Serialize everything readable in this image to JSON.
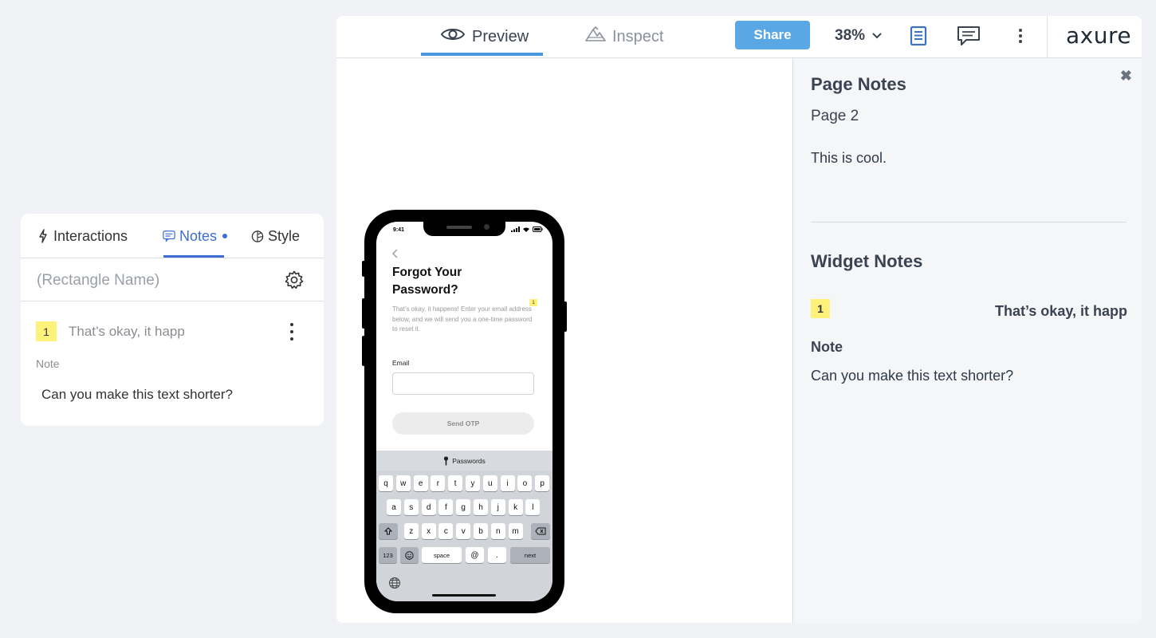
{
  "left_panel": {
    "tabs": [
      {
        "label": "Interactions"
      },
      {
        "label": "Notes"
      },
      {
        "label": "Style"
      }
    ],
    "name_placeholder": "(Rectangle Name)",
    "note": {
      "badge": "1",
      "title": "That’s okay, it happ",
      "label": "Note",
      "text": "Can you make this text shorter?"
    }
  },
  "toolbar": {
    "preview_label": "Preview",
    "inspect_label": "Inspect",
    "share_label": "Share",
    "zoom": "38%",
    "logo": "axure"
  },
  "phone": {
    "time": "9:41",
    "title": "Forgot Your Password?",
    "subtitle": "That’s okay, it happens! Enter your email address below, and we will send you a one-time password to reset it.",
    "pin_badge": "1",
    "email_label": "Email",
    "email_value": "",
    "send_button": "Send OTP",
    "keyboard": {
      "passwords_label": "Passwords",
      "row1": [
        "q",
        "w",
        "e",
        "r",
        "t",
        "y",
        "u",
        "i",
        "o",
        "p"
      ],
      "row2": [
        "a",
        "s",
        "d",
        "f",
        "g",
        "h",
        "j",
        "k",
        "l"
      ],
      "row3": [
        "z",
        "x",
        "c",
        "v",
        "b",
        "n",
        "m"
      ],
      "numbers": "123",
      "space": "space",
      "at": "@",
      "dot": ".",
      "next": "next"
    }
  },
  "notes_panel": {
    "page_heading": "Page Notes",
    "page_name": "Page 2",
    "page_note": "This is cool.",
    "widget_heading": "Widget Notes",
    "widget_badge": "1",
    "widget_title": "That’s okay, it happ",
    "note_label": "Note",
    "note_text": "Can you make this text shorter?"
  },
  "colors": {
    "accent": "#3f6ed3",
    "share": "#5aa7e6",
    "badge": "#fff27a"
  }
}
